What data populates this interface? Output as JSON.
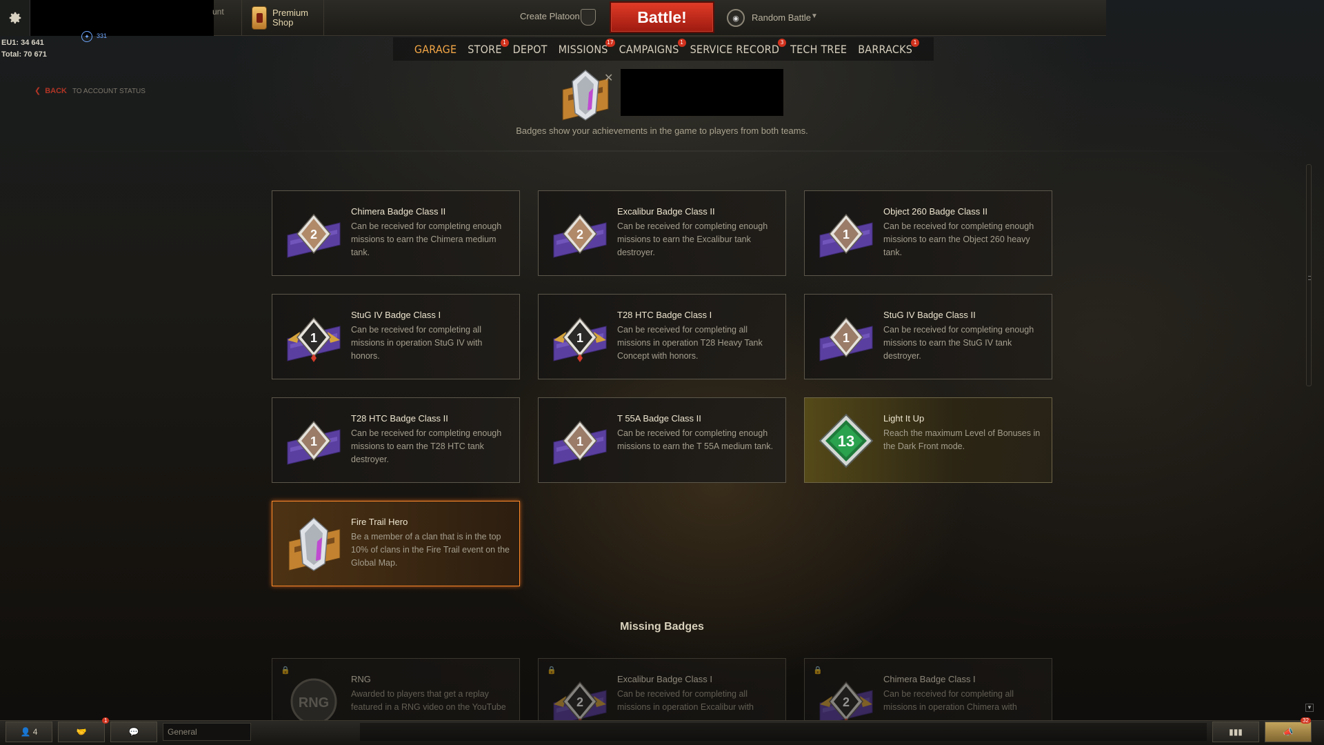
{
  "topbar": {
    "account_stub": "unt",
    "premium_shop": [
      "Premium",
      "Shop"
    ],
    "create_platoon": "Create Platoon",
    "battle_button": "Battle!",
    "battle_mode": "Random Battle",
    "credits_line1": "EU1: 34 641",
    "credits_line2": "Total: 70 671",
    "xp_value": "331"
  },
  "nav": {
    "items": [
      {
        "label": "GARAGE",
        "badge": ""
      },
      {
        "label": "STORE",
        "badge": "1"
      },
      {
        "label": "DEPOT",
        "badge": ""
      },
      {
        "label": "MISSIONS",
        "badge": "17"
      },
      {
        "label": "CAMPAIGNS",
        "badge": "1"
      },
      {
        "label": "SERVICE RECORD",
        "badge": "3"
      },
      {
        "label": "TECH TREE",
        "badge": ""
      },
      {
        "label": "BARRACKS",
        "badge": "1"
      }
    ]
  },
  "back": {
    "label": "BACK",
    "rest": "TO ACCOUNT STATUS"
  },
  "header": {
    "description": "Badges show your achievements in the game to players from both teams."
  },
  "badges": [
    {
      "title": "Chimera Badge Class II",
      "desc": "Can be received for completing enough missions to earn the Chimera medium tank.",
      "number": "2"
    },
    {
      "title": "Excalibur Badge Class II",
      "desc": "Can be received for completing enough missions to earn the Excalibur tank destroyer.",
      "number": "2"
    },
    {
      "title": "Object 260 Badge Class II",
      "desc": "Can be received for completing enough missions to earn the Object 260 heavy tank.",
      "number": "1"
    },
    {
      "title": "StuG IV Badge Class I",
      "desc": "Can be received for completing all missions in operation StuG IV with honors.",
      "number": "1"
    },
    {
      "title": "T28 HTC Badge Class I",
      "desc": "Can be received for completing all missions in operation T28 Heavy Tank Concept with honors.",
      "number": "1"
    },
    {
      "title": "StuG IV Badge Class II",
      "desc": "Can be received for completing enough missions to earn the StuG IV tank destroyer.",
      "number": "1"
    },
    {
      "title": "T28 HTC Badge Class II",
      "desc": "Can be received for completing enough missions to earn the T28 HTC tank destroyer.",
      "number": "1"
    },
    {
      "title": "T 55A Badge Class II",
      "desc": "Can be received for completing enough missions to earn the T 55A medium tank.",
      "number": "1"
    },
    {
      "title": "Light It Up",
      "desc": "Reach the maximum Level of Bonuses in the Dark Front mode.",
      "number": "13"
    },
    {
      "title": "Fire Trail Hero",
      "desc": "Be a member of a clan that is in the top 10% of clans in the Fire Trail event on the Global Map.",
      "number": ""
    }
  ],
  "missing_section": {
    "title": "Missing Badges",
    "badges": [
      {
        "title": "RNG",
        "desc": "Awarded to players that get a replay featured in a RNG video on the YouTube channel.",
        "number": "RNG"
      },
      {
        "title": "Excalibur Badge Class I",
        "desc": "Can be received for completing all missions in operation Excalibur with honors.",
        "number": "2"
      },
      {
        "title": "Chimera Badge Class I",
        "desc": "Can be received for completing all missions in operation Chimera with honors.",
        "number": "2"
      }
    ]
  },
  "bottombar": {
    "friends_count": "4",
    "clan_badge": "1",
    "chat_channel": "General",
    "notifications_badge": "32"
  },
  "colors": {
    "accent_orange": "#f3a646",
    "battle_red": "#c62a18",
    "badge_red": "#d1321e",
    "selected_border": "#ff8a2a"
  }
}
